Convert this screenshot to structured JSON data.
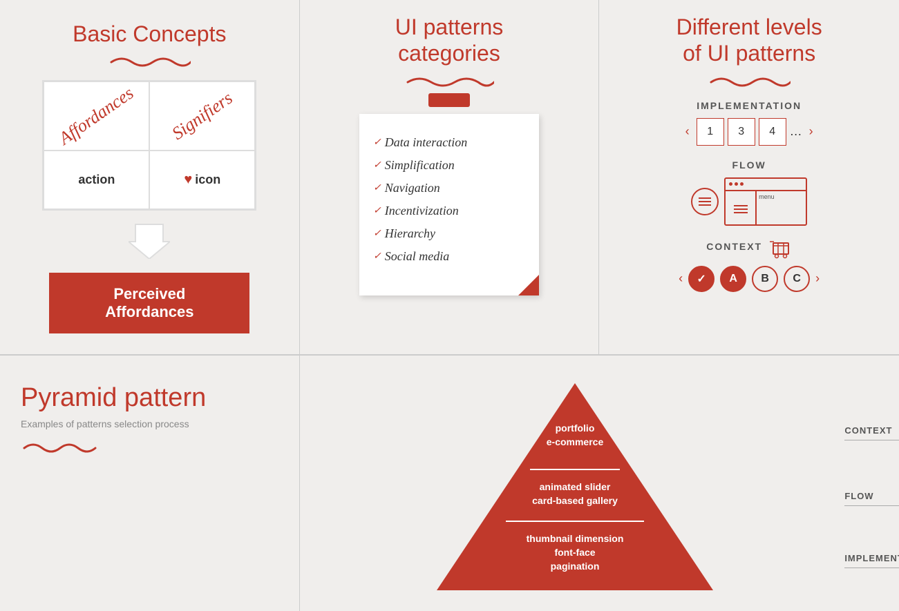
{
  "panel1": {
    "title": "Basic Concepts",
    "affordances_label": "Affordances",
    "signifiers_label": "Signifiers",
    "action_label": "action",
    "icon_label": "icon",
    "perceived_label": "Perceived Affordances"
  },
  "panel2": {
    "title": "UI patterns\ncategories",
    "items": [
      "Data interaction",
      "Simplification",
      "Navigation",
      "Incentivization",
      "Hierarchy",
      "Social media"
    ]
  },
  "panel3": {
    "title": "Different levels\nof UI patterns",
    "implementation_label": "IMPLEMENTATION",
    "flow_label": "FLOW",
    "context_label": "CONTEXT",
    "pagination": [
      "1",
      "3",
      "4",
      "…"
    ],
    "menu_label": "menu",
    "steps": [
      "✓",
      "A",
      "B",
      "C"
    ]
  },
  "bottom": {
    "pyramid_title": "Pyramid pattern",
    "pyramid_subtitle": "Examples of patterns selection process",
    "context_level": "CONTEXT",
    "flow_level": "FLOW",
    "implementation_level": "IMPLEMENTATION",
    "top_content": "portfolio\ne-commerce",
    "mid_content": "animated slider\ncard-based gallery",
    "bottom_content": "thumbnail dimension\nfont-face\npagination"
  },
  "colors": {
    "orange": "#c0392b",
    "bg": "#f0eeec"
  }
}
